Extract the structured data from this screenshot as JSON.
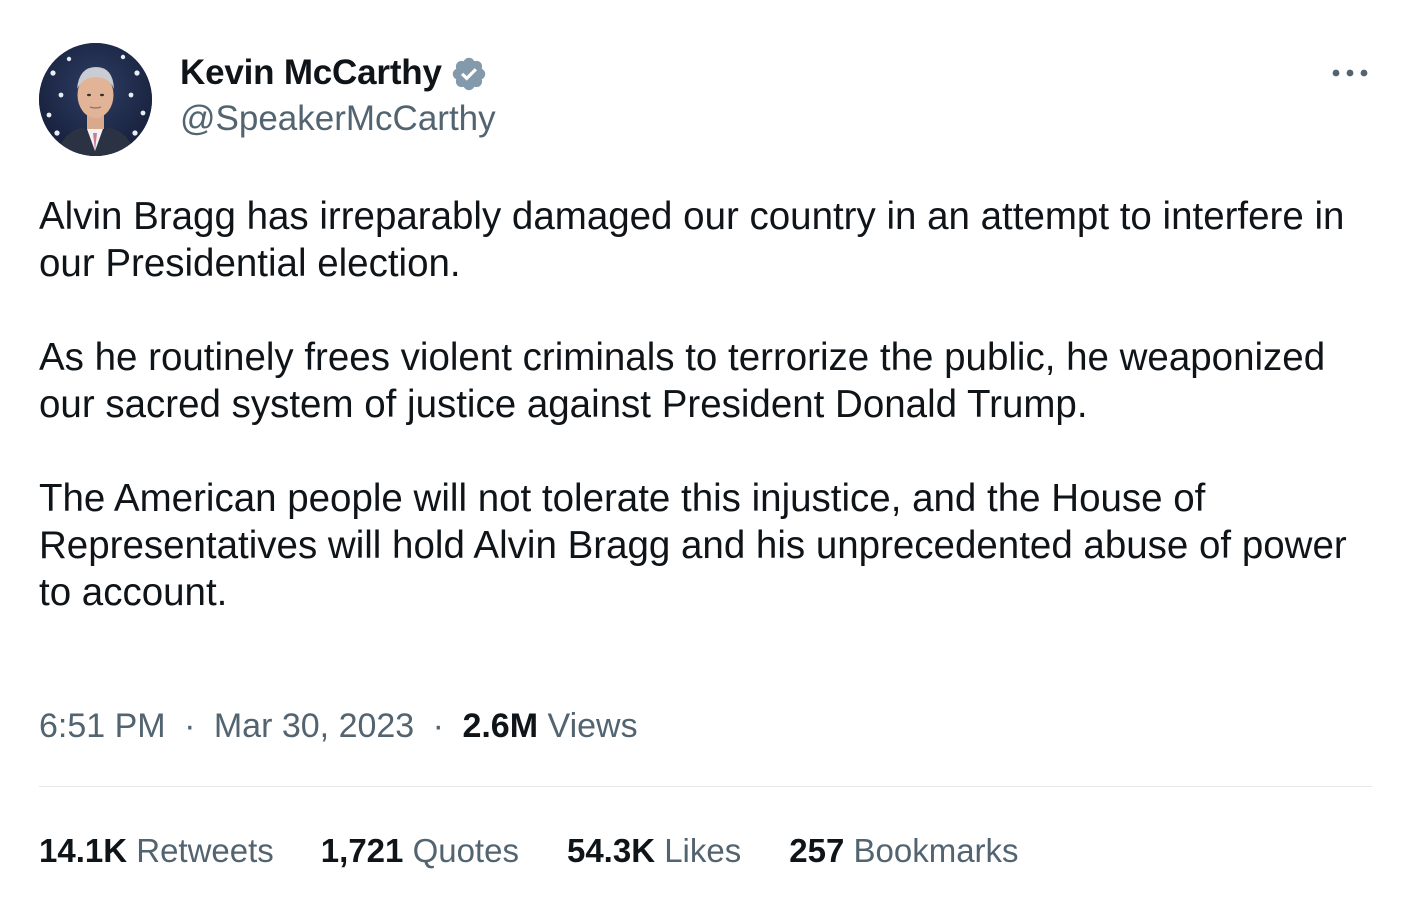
{
  "author": {
    "display_name": "Kevin McCarthy",
    "handle": "@SpeakerMcCarthy",
    "verified_icon": "verified-badge-icon",
    "more_icon": "more-options-icon"
  },
  "colors": {
    "text_primary": "#0f1419",
    "text_secondary": "#536471",
    "verified_badge": "#829aab",
    "divider": "#e6e8ea"
  },
  "tweet": {
    "paragraphs": [
      "Alvin Bragg has irreparably damaged our country in an attempt to interfere in our Presidential election.",
      "As he routinely frees violent criminals to terrorize the public, he weaponized our sacred system of justice against President Donald Trump.",
      "The American people will not tolerate this injustice, and the House of Representatives will hold Alvin Bragg and his unprecedented abuse of power to account."
    ]
  },
  "meta": {
    "time": "6:51 PM",
    "separator": "·",
    "date": "Mar 30, 2023",
    "views_count": "2.6M",
    "views_label": "Views"
  },
  "stats": {
    "retweets": {
      "count": "14.1K",
      "label": "Retweets"
    },
    "quotes": {
      "count": "1,721",
      "label": "Quotes"
    },
    "likes": {
      "count": "54.3K",
      "label": "Likes"
    },
    "bookmarks": {
      "count": "257",
      "label": "Bookmarks"
    }
  }
}
